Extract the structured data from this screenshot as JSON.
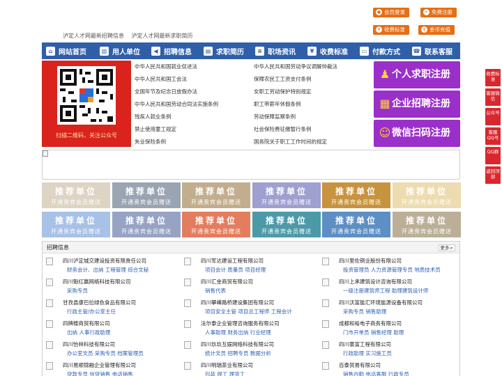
{
  "header": {
    "tagline": [
      "泸定人才网最新招聘信息",
      "泸定人才网最新求职简历"
    ],
    "buttons": [
      {
        "label": "会员登录",
        "icon": "user-icon"
      },
      {
        "label": "免费注册",
        "icon": "user-add-icon"
      },
      {
        "label": "收费标准",
        "icon": "yen-icon"
      },
      {
        "label": "金币充值",
        "icon": "coin-icon"
      }
    ],
    "accent": "#e66e16"
  },
  "nav": {
    "color": "#2f5fa8",
    "items": [
      {
        "label": "网站首页",
        "icon": "home-icon"
      },
      {
        "label": "用人单位",
        "icon": "building-icon"
      },
      {
        "label": "招聘信息",
        "icon": "megaphone-icon"
      },
      {
        "label": "求职简历",
        "icon": "resume-icon"
      },
      {
        "label": "职场资讯",
        "icon": "news-icon"
      },
      {
        "label": "收费标准",
        "icon": "yen-icon"
      },
      {
        "label": "付款方式",
        "icon": "wallet-icon"
      },
      {
        "label": "联系客服",
        "icon": "phone-icon"
      }
    ]
  },
  "qr": {
    "caption": "扫描二维码，关注公众号",
    "bg": "#d9231c"
  },
  "laws": {
    "left": [
      "中华人民共和国就业促进法",
      "中华人民共和国工会法",
      "全国年节及纪念日放假办法",
      "中华人民共和国劳动合同法实施条例",
      "残疾人就业条例",
      "禁止使用童工规定",
      "失业保险条例"
    ],
    "right": [
      "中华人民共和国劳动争议调解仲裁法",
      "保障农民工工资支付条例",
      "女职工劳动保护特别规定",
      "职工带薪年休假条例",
      "劳动保障监察条例",
      "社会保险费征缴暂行条例",
      "国务院关于职工工作时间的规定"
    ]
  },
  "register": {
    "color": "#9b2fc9",
    "buttons": [
      {
        "label": "个人求职注册",
        "icon": "person-icon"
      },
      {
        "label": "企业招聘注册",
        "icon": "company-icon"
      },
      {
        "label": "微信扫码注册",
        "icon": "wechat-icon"
      }
    ]
  },
  "ads": {
    "title": "推荐单位",
    "subtitle": "开通贵宾会员赠送",
    "colors": [
      "#ddd4c4",
      "#9aa4b2",
      "#c2ae8d",
      "#9f9fd0",
      "#c8933e",
      "#eddcb0",
      "#a8c1e6",
      "#96a3c3",
      "#e47c5e",
      "#4c9aa8",
      "#5d8fc4",
      "#bcaf97"
    ]
  },
  "jobs": {
    "title": "招聘信息",
    "more": "更多>",
    "rows": [
      [
        {
          "company": "四川泸定城交建设投资有限责任公司",
          "positions": "财务会计、出纳 工程管理 综合文秘"
        },
        {
          "company": "四川军达建设工程有限公司",
          "positions": "项目会计 质量员 项目经理"
        },
        {
          "company": "四川里佐铜业股份有限公司",
          "positions": "投资管理员 人力资源管理专员 地质技术员"
        }
      ],
      [
        {
          "company": "四川魁红赢网络科技有限公司",
          "positions": "采购专员"
        },
        {
          "company": "四川汇金商贸有限公司",
          "positions": "销售代表"
        },
        {
          "company": "四川上承建筑设计咨询有限公司",
          "positions": "一级注册建筑师工程 助理建筑设计师"
        }
      ],
      [
        {
          "company": "甘孜县康巴拉绿色食品有限公司",
          "positions": "行政主管/办公室主任"
        },
        {
          "company": "四川攀峰路桥建设集团有限公司",
          "positions": "项目安全主管 项目总工程师 工程会计"
        },
        {
          "company": "四川沃富能汇环境能源设备有限公司",
          "positions": "采购专员 销售助理"
        }
      ],
      [
        {
          "company": "四牌楼商贸有限公司",
          "positions": "出纳 人事行政助理"
        },
        {
          "company": "法尔泰企业管理咨询服务有限公司",
          "positions": "人事助理 财务出纳 行业经理"
        },
        {
          "company": "成都和裕电子商务有限公司",
          "positions": "门市开单员 销售经理 助理"
        }
      ],
      [
        {
          "company": "四川怡林科技有限公司",
          "positions": "办公室文员 采购专员 档案管理员"
        },
        {
          "company": "四川玖玖互娱网络科技有限公司",
          "positions": "统计文员 招聘专员 数据分析"
        },
        {
          "company": "四川豪富工程有限公司",
          "positions": "行政助理 实习施工员"
        }
      ],
      [
        {
          "company": "四川易顺锦融企业管理有限公司",
          "positions": "贷款专员 信贷销售 电话销售"
        },
        {
          "company": "四川明瑞茶业有限公司",
          "positions": "包装 焊工 理货工"
        },
        {
          "company": "百泰贸易有限公司",
          "positions": "销售内勤 电话客服 行政专员"
        }
      ]
    ]
  },
  "sidebar": {
    "color": "#d9272e",
    "buttons": [
      "收费标准",
      "客服微信",
      "公众号",
      "客服QQ号",
      "QQ群",
      "返回顶部"
    ]
  }
}
